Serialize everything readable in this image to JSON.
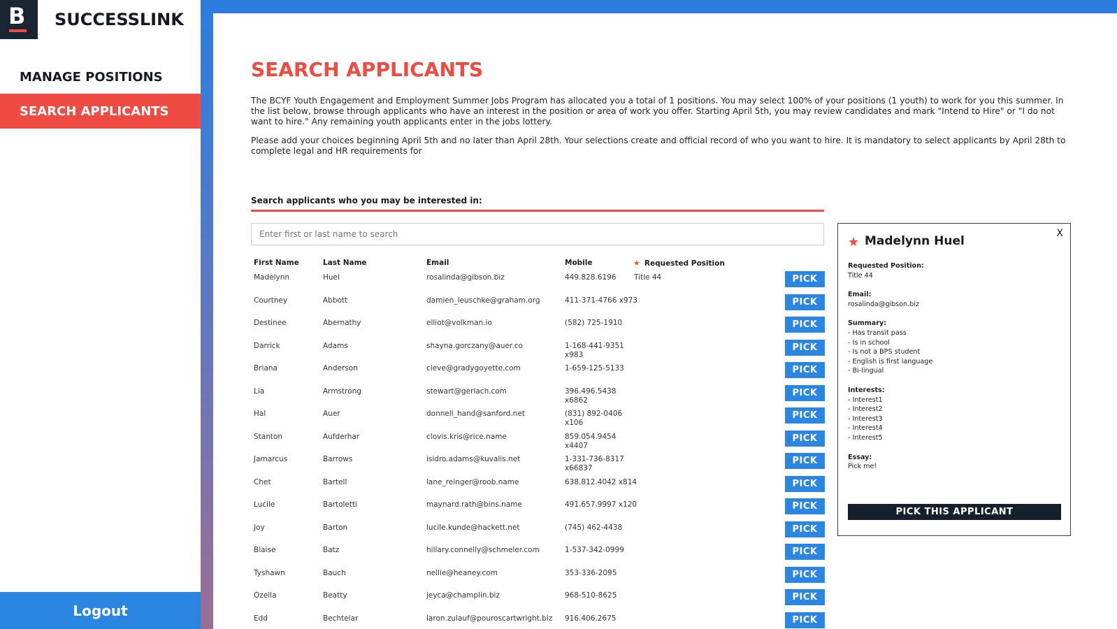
{
  "app": {
    "brand_letter": "B",
    "brand_name": "SUCCESSLINK"
  },
  "nav": {
    "items": [
      {
        "label": "MANAGE POSITIONS"
      },
      {
        "label": "SEARCH APPLICANTS"
      }
    ],
    "logout": "Logout"
  },
  "page": {
    "title": "SEARCH APPLICANTS",
    "intro1": "The BCYF Youth Engagement and Employment Summer Jobs Program has allocated you a total of 1 positions. You may select 100% of your positions (1 youth) to work for you this summer. In the list below, browse through applicants who have an interest in the position or area of work you offer. Starting April 5th, you may review candidates and mark \"Intend to Hire\" or \"I do not want to hire.\" Any remaining youth applicants enter in the jobs lottery.",
    "intro2": "Please add your choices beginning April 5th and no later than April 28th. Your selections create and official record of who you want to hire. It is mandatory to select applicants by April 28th to complete legal and HR requirements for",
    "search_label": "Search applicants who you may be interested in:",
    "search_placeholder": "Enter first or last name to search"
  },
  "table": {
    "headers": {
      "first": "First Name",
      "last": "Last Name",
      "email": "Email",
      "mobile": "Mobile",
      "position": "Requested Position"
    },
    "pick_label": "PICK",
    "rows": [
      {
        "first": "Madelynn",
        "last": "Huel",
        "email": "rosalinda@gibson.biz",
        "mobile": "449.828.6196",
        "mobile2": "",
        "position": "Title 44"
      },
      {
        "first": "Courtney",
        "last": "Abbott",
        "email": "damien_leuschke@graham.org",
        "mobile": "411-371-4766 x973",
        "mobile2": "",
        "position": ""
      },
      {
        "first": "Destinee",
        "last": "Abernathy",
        "email": "elliot@volkman.io",
        "mobile": "(582) 725-1910",
        "mobile2": "",
        "position": ""
      },
      {
        "first": "Darrick",
        "last": "Adams",
        "email": "shayna.gorczany@auer.co",
        "mobile": "1-168-441-9351",
        "mobile2": "x983",
        "position": ""
      },
      {
        "first": "Briana",
        "last": "Anderson",
        "email": "cleve@gradygoyette.com",
        "mobile": "1-659-125-5133",
        "mobile2": "",
        "position": ""
      },
      {
        "first": "Lia",
        "last": "Armstrong",
        "email": "stewart@gerlach.com",
        "mobile": "396.496.5438",
        "mobile2": "x6862",
        "position": ""
      },
      {
        "first": "Hal",
        "last": "Auer",
        "email": "donnell_hand@sanford.net",
        "mobile": "(831) 892-0406",
        "mobile2": "x106",
        "position": ""
      },
      {
        "first": "Stanton",
        "last": "Aufderhar",
        "email": "clovis.kris@rice.name",
        "mobile": "859.054.9454",
        "mobile2": "x4407",
        "position": ""
      },
      {
        "first": "Jamarcus",
        "last": "Barrows",
        "email": "isidro.adams@kuvalis.net",
        "mobile": "1-331-736-8317",
        "mobile2": "x66837",
        "position": ""
      },
      {
        "first": "Chet",
        "last": "Bartell",
        "email": "lane_reinger@roob.name",
        "mobile": "638.812.4042 x814",
        "mobile2": "",
        "position": ""
      },
      {
        "first": "Lucile",
        "last": "Bartoletti",
        "email": "maynard.rath@bins.name",
        "mobile": "491.657.9997 x120",
        "mobile2": "",
        "position": ""
      },
      {
        "first": "Joy",
        "last": "Barton",
        "email": "lucile.kunde@hackett.net",
        "mobile": "(745) 462-4438",
        "mobile2": "",
        "position": ""
      },
      {
        "first": "Blaise",
        "last": "Batz",
        "email": "hillary.connelly@schmeler.com",
        "mobile": "1-537-342-0999",
        "mobile2": "",
        "position": ""
      },
      {
        "first": "Tyshawn",
        "last": "Bauch",
        "email": "nellie@heaney.com",
        "mobile": "353-336-2095",
        "mobile2": "",
        "position": ""
      },
      {
        "first": "Ozella",
        "last": "Beatty",
        "email": "jeyca@champlin.biz",
        "mobile": "968-510-8625",
        "mobile2": "",
        "position": ""
      },
      {
        "first": "Edd",
        "last": "Bechtelar",
        "email": "laron.zulauf@pouroscartwright.biz",
        "mobile": "916.406.2675",
        "mobile2": "",
        "position": ""
      }
    ]
  },
  "card": {
    "close": "X",
    "name": "Madelynn Huel",
    "requested_label": "Requested Position:",
    "requested_value": "Title 44",
    "email_label": "Email:",
    "email_value": "rosalinda@gibson.biz",
    "summary_label": "Summary:",
    "summary_items": [
      "- Has transit pass",
      "- Is in school",
      "- Is not a BPS student",
      "- English is first language",
      "- Bi-lingual"
    ],
    "interests_label": "Interests:",
    "interests_items": [
      "- Interest1",
      "- Interest2",
      "- Interest3",
      "- Interest4",
      "- Interest5"
    ],
    "essay_label": "Essay:",
    "essay_value": "Pick me!",
    "pick_button": "PICK THIS APPLICANT"
  },
  "colors": {
    "accent_red": "#ef4b42",
    "accent_blue": "#2b86e2",
    "dark_navy": "#16202d"
  }
}
